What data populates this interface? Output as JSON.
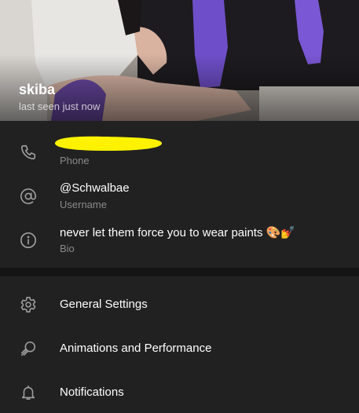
{
  "header": {
    "name": "skiba",
    "status": "last seen just now"
  },
  "info": {
    "phone_label": "Phone",
    "username_value": "@Schwalbae",
    "username_label": "Username",
    "bio_value": "never let them force you to wear paints 🎨💅",
    "bio_label": "Bio"
  },
  "menu": {
    "items": [
      {
        "label": "General Settings",
        "icon": "gear-icon"
      },
      {
        "label": "Animations and Performance",
        "icon": "animation-icon"
      },
      {
        "label": "Notifications",
        "icon": "bell-icon"
      }
    ]
  },
  "colors": {
    "background": "#212121",
    "divider": "#141414",
    "redaction": "#FFF200"
  }
}
